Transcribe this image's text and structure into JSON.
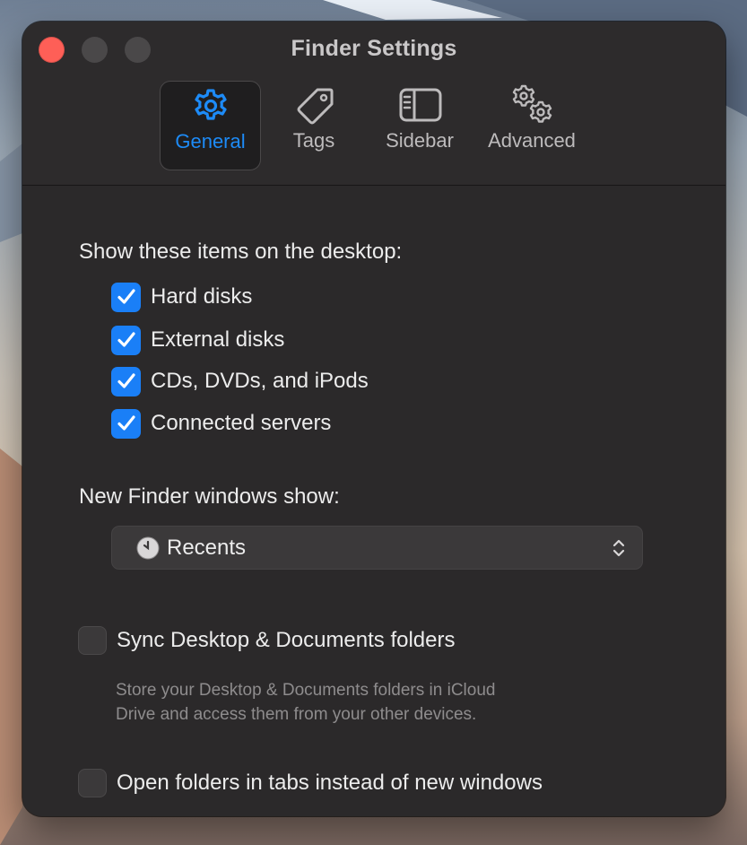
{
  "window": {
    "title": "Finder Settings"
  },
  "tabs": [
    {
      "label": "General",
      "icon": "gear-icon",
      "active": true
    },
    {
      "label": "Tags",
      "icon": "tag-icon",
      "active": false
    },
    {
      "label": "Sidebar",
      "icon": "sidebar-icon",
      "active": false
    },
    {
      "label": "Advanced",
      "icon": "gears-icon",
      "active": false
    }
  ],
  "desktop": {
    "heading": "Show these items on the desktop:",
    "items": [
      {
        "label": "Hard disks",
        "checked": true
      },
      {
        "label": "External disks",
        "checked": true
      },
      {
        "label": "CDs, DVDs, and iPods",
        "checked": true
      },
      {
        "label": "Connected servers",
        "checked": true
      }
    ]
  },
  "new_window": {
    "heading": "New Finder windows show:",
    "selected": "Recents",
    "icon": "clock-icon"
  },
  "sync": {
    "label": "Sync Desktop & Documents folders",
    "checked": false,
    "description_line1": "Store your Desktop & Documents folders in iCloud",
    "description_line2": "Drive and access them from your other devices."
  },
  "tabs_option": {
    "label": "Open folders in tabs instead of new windows",
    "checked": false
  },
  "colors": {
    "accent": "#1d8bf7",
    "checkbox": "#1a7ff7",
    "close": "#fe5f57",
    "window_bg": "#2b292a"
  }
}
